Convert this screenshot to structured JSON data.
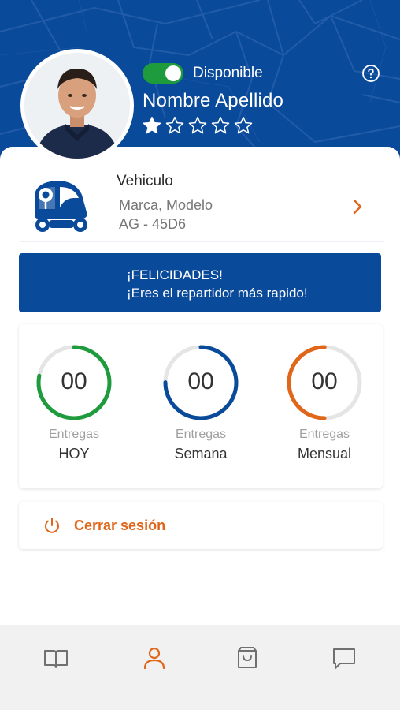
{
  "colors": {
    "brand_blue": "#0a4a9a",
    "accent_orange": "#e0661a",
    "green": "#1e9b3c",
    "blue_ring": "#0a4a9a",
    "orange_ring": "#e0661a"
  },
  "profile": {
    "status_label": "Disponible",
    "available": true,
    "name": "Nombre Apellido",
    "rating": 1,
    "rating_max": 5,
    "help_icon": "question-circle-icon",
    "avatar_icon": "user-photo"
  },
  "vehicle": {
    "title": "Vehiculo",
    "model": "Marca, Modelo",
    "plate": "AG - 45D6",
    "icon": "tuk-tuk-vehicle-icon"
  },
  "banner": {
    "line1": "¡FELICIDADES!",
    "line2": "¡Eres el repartidor más rapido!"
  },
  "stats": [
    {
      "value": "00",
      "subtitle": "Entregas",
      "label": "HOY",
      "color": "#1e9b3c",
      "progress": 0.78
    },
    {
      "value": "00",
      "subtitle": "Entregas",
      "label": "Semana",
      "color": "#0a4a9a",
      "progress": 0.75
    },
    {
      "value": "00",
      "subtitle": "Entregas",
      "label": "Mensual",
      "color": "#e0661a",
      "progress": 0.5
    }
  ],
  "logout": {
    "label": "Cerrar sesión",
    "icon": "power-icon"
  },
  "nav": [
    {
      "name": "book-icon",
      "active": false
    },
    {
      "name": "user-icon",
      "active": true
    },
    {
      "name": "shopping-bag-icon",
      "active": false
    },
    {
      "name": "chat-icon",
      "active": false
    }
  ]
}
